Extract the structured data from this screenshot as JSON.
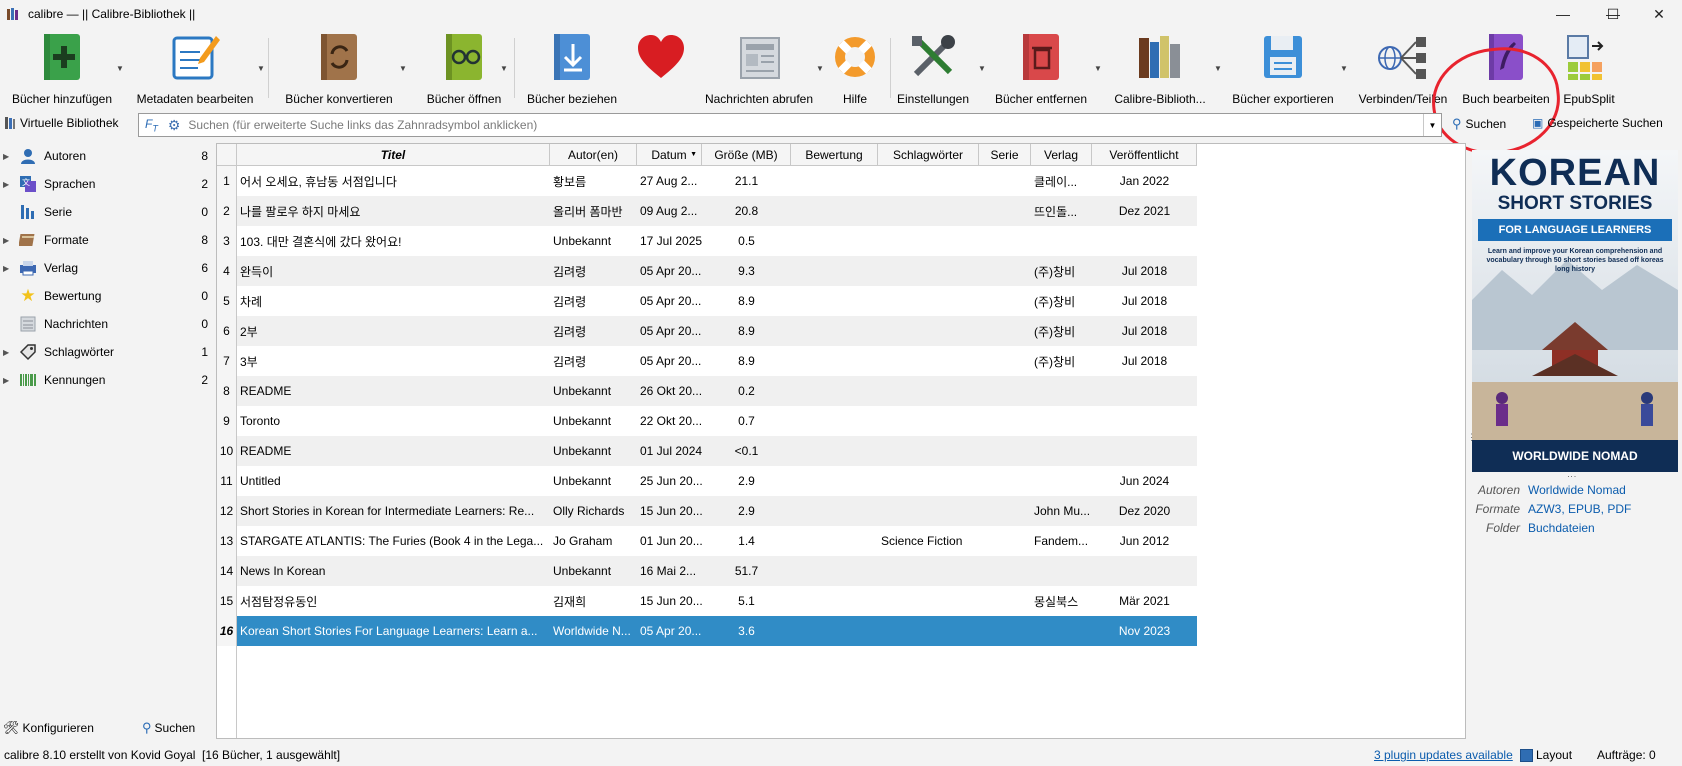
{
  "window": {
    "title": "calibre — || Calibre-Bibliothek ||",
    "controls": {
      "minimize": "—",
      "maximize": "☐",
      "close": "✕"
    }
  },
  "toolbar": {
    "buttons": [
      {
        "id": "add",
        "label": "Bücher hinzufügen",
        "icon": "add-book-icon"
      },
      {
        "id": "metadata",
        "label": "Metadaten bearbeiten",
        "icon": "edit-metadata-icon"
      },
      {
        "id": "convert",
        "label": "Bücher konvertieren",
        "icon": "convert-icon"
      },
      {
        "id": "view",
        "label": "Bücher öffnen",
        "icon": "view-book-icon"
      },
      {
        "id": "fetch",
        "label": "Bücher beziehen",
        "icon": "download-book-icon"
      },
      {
        "id": "donate",
        "label": "",
        "icon": "heart-icon"
      },
      {
        "id": "news",
        "label": "Nachrichten abrufen",
        "icon": "news-icon"
      },
      {
        "id": "help",
        "label": "Hilfe",
        "icon": "lifebuoy-icon"
      },
      {
        "id": "prefs",
        "label": "Einstellungen",
        "icon": "tools-icon"
      },
      {
        "id": "remove",
        "label": "Bücher entfernen",
        "icon": "trash-book-icon"
      },
      {
        "id": "library",
        "label": "Calibre-Biblioth...",
        "icon": "library-icon"
      },
      {
        "id": "save",
        "label": "Bücher exportieren",
        "icon": "save-icon"
      },
      {
        "id": "connect",
        "label": "Verbinden/Teilen",
        "icon": "connect-share-icon"
      },
      {
        "id": "tweak",
        "label": "Buch bearbeiten",
        "icon": "edit-book-icon"
      },
      {
        "id": "epubsplit",
        "label": "EpubSplit",
        "icon": "epubsplit-icon"
      }
    ]
  },
  "search": {
    "virtual_library": "Virtuelle Bibliothek",
    "placeholder": "Suchen (für erweiterte Suche links das Zahnradsymbol anklicken)",
    "search_button": "Suchen",
    "saved_searches": "Gespeicherte Suchen"
  },
  "tag_browser": {
    "items": [
      {
        "label": "Autoren",
        "count": "8",
        "icon": "person-icon",
        "expandable": true
      },
      {
        "label": "Sprachen",
        "count": "2",
        "icon": "language-icon",
        "expandable": true
      },
      {
        "label": "Serie",
        "count": "0",
        "icon": "series-icon",
        "expandable": false
      },
      {
        "label": "Formate",
        "count": "8",
        "icon": "book-icon",
        "expandable": true
      },
      {
        "label": "Verlag",
        "count": "6",
        "icon": "publisher-icon",
        "expandable": true
      },
      {
        "label": "Bewertung",
        "count": "0",
        "icon": "star-icon",
        "expandable": false
      },
      {
        "label": "Nachrichten",
        "count": "0",
        "icon": "news-small-icon",
        "expandable": false
      },
      {
        "label": "Schlagwörter",
        "count": "1",
        "icon": "tag-icon",
        "expandable": true
      },
      {
        "label": "Kennungen",
        "count": "2",
        "icon": "barcode-icon",
        "expandable": true
      }
    ],
    "configure": "Konfigurieren",
    "find": "Suchen"
  },
  "table": {
    "columns": [
      "Titel",
      "Autor(en)",
      "Datum",
      "Größe (MB)",
      "Bewertung",
      "Schlagwörter",
      "Serie",
      "Verlag",
      "Veröffentlicht"
    ],
    "rows": [
      {
        "n": "1",
        "title": "어서 오세요, 휴남동 서점입니다",
        "author": "황보름",
        "date": "27 Aug 2...",
        "size": "21.1",
        "rating": "",
        "tags": "",
        "series": "",
        "publisher": "클레이...",
        "published": "Jan 2022"
      },
      {
        "n": "2",
        "title": "나를 팔로우 하지 마세요",
        "author": "올리버 폼마반",
        "date": "09 Aug 2...",
        "size": "20.8",
        "rating": "",
        "tags": "",
        "series": "",
        "publisher": "뜨인돌...",
        "published": "Dez 2021"
      },
      {
        "n": "3",
        "title": "103. 대만 결혼식에 갔다 왔어요!",
        "author": "Unbekannt",
        "date": "17 Jul 2025",
        "size": "0.5",
        "rating": "",
        "tags": "",
        "series": "",
        "publisher": "",
        "published": ""
      },
      {
        "n": "4",
        "title": "완득이",
        "author": "김려령",
        "date": "05 Apr 20...",
        "size": "9.3",
        "rating": "",
        "tags": "",
        "series": "",
        "publisher": "(주)창비",
        "published": "Jul 2018"
      },
      {
        "n": "5",
        "title": "차례",
        "author": "김려령",
        "date": "05 Apr 20...",
        "size": "8.9",
        "rating": "",
        "tags": "",
        "series": "",
        "publisher": "(주)창비",
        "published": "Jul 2018"
      },
      {
        "n": "6",
        "title": "2부",
        "author": "김려령",
        "date": "05 Apr 20...",
        "size": "8.9",
        "rating": "",
        "tags": "",
        "series": "",
        "publisher": "(주)창비",
        "published": "Jul 2018"
      },
      {
        "n": "7",
        "title": "3부",
        "author": "김려령",
        "date": "05 Apr 20...",
        "size": "8.9",
        "rating": "",
        "tags": "",
        "series": "",
        "publisher": "(주)창비",
        "published": "Jul 2018"
      },
      {
        "n": "8",
        "title": "README",
        "author": "Unbekannt",
        "date": "26 Okt 20...",
        "size": "0.2",
        "rating": "",
        "tags": "",
        "series": "",
        "publisher": "",
        "published": ""
      },
      {
        "n": "9",
        "title": "Toronto",
        "author": "Unbekannt",
        "date": "22 Okt 20...",
        "size": "0.7",
        "rating": "",
        "tags": "",
        "series": "",
        "publisher": "",
        "published": ""
      },
      {
        "n": "10",
        "title": "README",
        "author": "Unbekannt",
        "date": "01 Jul 2024",
        "size": "<0.1",
        "rating": "",
        "tags": "",
        "series": "",
        "publisher": "",
        "published": ""
      },
      {
        "n": "11",
        "title": "Untitled",
        "author": "Unbekannt",
        "date": "25 Jun 20...",
        "size": "2.9",
        "rating": "",
        "tags": "",
        "series": "",
        "publisher": "",
        "published": "Jun 2024"
      },
      {
        "n": "12",
        "title": "Short Stories in Korean for Intermediate Learners: Re...",
        "author": "Olly Richards",
        "date": "15 Jun 20...",
        "size": "2.9",
        "rating": "",
        "tags": "",
        "series": "",
        "publisher": "John Mu...",
        "published": "Dez 2020"
      },
      {
        "n": "13",
        "title": "STARGATE ATLANTIS: The Furies (Book 4 in the Lega...",
        "author": "Jo Graham",
        "date": "01 Jun 20...",
        "size": "1.4",
        "rating": "",
        "tags": "Science Fiction",
        "series": "",
        "publisher": "Fandem...",
        "published": "Jun 2012"
      },
      {
        "n": "14",
        "title": "News In Korean",
        "author": "Unbekannt",
        "date": "16 Mai 2...",
        "size": "51.7",
        "rating": "",
        "tags": "",
        "series": "",
        "publisher": "",
        "published": ""
      },
      {
        "n": "15",
        "title": "서점탐정유동인",
        "author": "김재희",
        "date": "15 Jun 20...",
        "size": "5.1",
        "rating": "",
        "tags": "",
        "series": "",
        "publisher": "몽실북스",
        "published": "Mär 2021"
      },
      {
        "n": "16",
        "title": "Korean Short Stories For Language Learners: Learn a...",
        "author": "Worldwide N...",
        "date": "05 Apr 20...",
        "size": "3.6",
        "rating": "",
        "tags": "",
        "series": "",
        "publisher": "",
        "published": "Nov 2023",
        "selected": true
      }
    ]
  },
  "cover": {
    "line1": "KOREAN",
    "line2": "SHORT STORIES",
    "banner": "FOR LANGUAGE LEARNERS",
    "blurb": "Learn and improve your Korean comprehension and vocabulary through 50 short stories based off koreas long history",
    "footer": "WORLDWIDE NOMAD"
  },
  "details": [
    {
      "key": "Autoren",
      "value": "Worldwide Nomad"
    },
    {
      "key": "Formate",
      "value": "AZW3, EPUB, PDF"
    },
    {
      "key": "Folder",
      "value": "Buchdateien"
    }
  ],
  "status": {
    "left": "calibre 8.10 erstellt von Kovid Goyal",
    "count": "[16 Bücher, 1 ausgewählt]",
    "plugins": "3 plugin updates available",
    "layout": "Layout",
    "jobs": "Aufträge: 0"
  },
  "colors": {
    "selection": "#308cc6",
    "highlight_annotation": "#e8232e",
    "link": "#0b5cad"
  }
}
